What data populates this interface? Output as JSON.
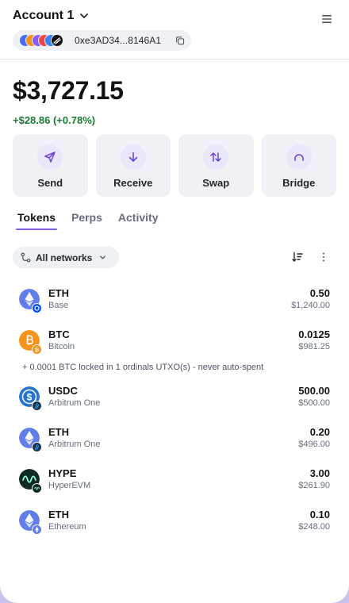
{
  "header": {
    "account_name": "Account 1",
    "address": "0xe3AD34...8146A1",
    "avatar_colors": [
      "#4a6cf7",
      "#f7931a",
      "#8b5cf6",
      "#ef4444",
      "#3b82f6",
      "#111111"
    ]
  },
  "balance": {
    "total": "$3,727.15",
    "change": "+$28.86 (+0.78%)",
    "change_color": "#1c7c33"
  },
  "actions": [
    {
      "label": "Send",
      "icon": "send-icon"
    },
    {
      "label": "Receive",
      "icon": "arrow-down-icon"
    },
    {
      "label": "Swap",
      "icon": "swap-icon"
    },
    {
      "label": "Bridge",
      "icon": "bridge-icon"
    }
  ],
  "tabs": [
    {
      "label": "Tokens",
      "active": true
    },
    {
      "label": "Perps",
      "active": false
    },
    {
      "label": "Activity",
      "active": false
    }
  ],
  "filter": {
    "networks_label": "All networks"
  },
  "tokens": [
    {
      "symbol": "ETH",
      "network": "Base",
      "amount": "0.50",
      "usd": "$1,240.00"
    },
    {
      "symbol": "BTC",
      "network": "Bitcoin",
      "amount": "0.0125",
      "usd": "$981.25"
    },
    {
      "symbol": "USDC",
      "network": "Arbitrum One",
      "amount": "500.00",
      "usd": "$500.00"
    },
    {
      "symbol": "ETH",
      "network": "Arbitrum One",
      "amount": "0.20",
      "usd": "$496.00"
    },
    {
      "symbol": "HYPE",
      "network": "HyperEVM",
      "amount": "3.00",
      "usd": "$261.90"
    },
    {
      "symbol": "ETH",
      "network": "Ethereum",
      "amount": "0.10",
      "usd": "$248.00"
    }
  ],
  "btc_note": "+ 0.0001 BTC locked in 1 ordinals UTXO(s) - never auto-spent",
  "colors": {
    "accent": "#7f5ae6",
    "eth": "#627eea",
    "btc": "#f7931a",
    "usdc": "#2775ca",
    "hype": "#0f2a24",
    "base": "#0052ff",
    "arbitrum": "#213147"
  }
}
